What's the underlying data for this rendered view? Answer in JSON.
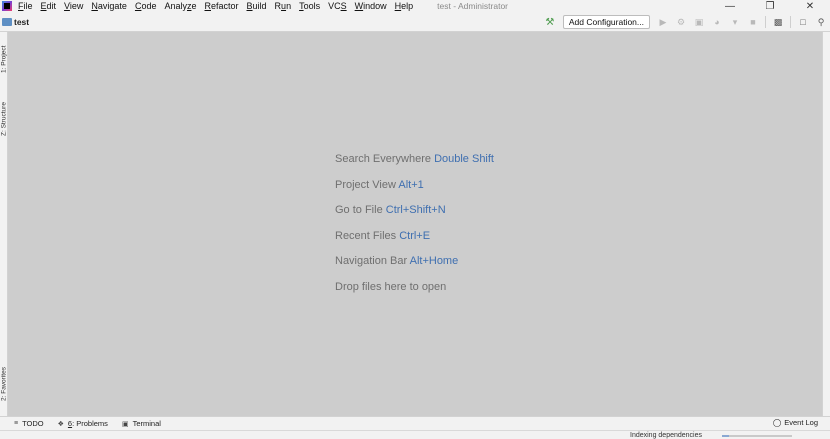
{
  "window": {
    "title": "test - Administrator",
    "controls": {
      "minimize": "—",
      "restore": "❐",
      "close": "✕"
    }
  },
  "menu": [
    {
      "mn": "F",
      "rest": "ile"
    },
    {
      "mn": "E",
      "rest": "dit"
    },
    {
      "mn": "V",
      "rest": "iew"
    },
    {
      "mn": "N",
      "rest": "avigate"
    },
    {
      "mn": "C",
      "rest": "ode"
    },
    {
      "pre": "Analy",
      "mn": "z",
      "rest": "e"
    },
    {
      "mn": "R",
      "rest": "efactor"
    },
    {
      "mn": "B",
      "rest": "uild"
    },
    {
      "pre": "R",
      "mn": "u",
      "rest": "n"
    },
    {
      "mn": "T",
      "rest": "ools"
    },
    {
      "pre": "VC",
      "mn": "S",
      "rest": ""
    },
    {
      "mn": "W",
      "rest": "indow"
    },
    {
      "mn": "H",
      "rest": "elp"
    }
  ],
  "navbar": {
    "project": "test",
    "add_configuration": "Add Configuration..."
  },
  "left_stripe": {
    "project_tab": "1: Project",
    "structure_tab": "Z: Structure",
    "favorites_tab": "2: Favorites"
  },
  "editor_hints": [
    {
      "text": "Search Everywhere",
      "shortcut": "Double Shift"
    },
    {
      "text": "Project View",
      "shortcut": "Alt+1"
    },
    {
      "text": "Go to File",
      "shortcut": "Ctrl+Shift+N"
    },
    {
      "text": "Recent Files",
      "shortcut": "Ctrl+E"
    },
    {
      "text": "Navigation Bar",
      "shortcut": "Alt+Home"
    },
    {
      "text": "Drop files here to open",
      "shortcut": ""
    }
  ],
  "bottom_tabs": {
    "todo": "TODO",
    "problems_mn": "6",
    "problems_rest": ": Problems",
    "terminal": "Terminal",
    "event_log": "Event Log"
  },
  "status": {
    "text": "Indexing dependencies",
    "progress": 0.1
  },
  "colors": {
    "editor_bg": "#cdcdcd",
    "shortcut_link": "#3f6fb0",
    "hint_text": "#6f6f6f",
    "build_hammer": "#4a9a4a"
  }
}
